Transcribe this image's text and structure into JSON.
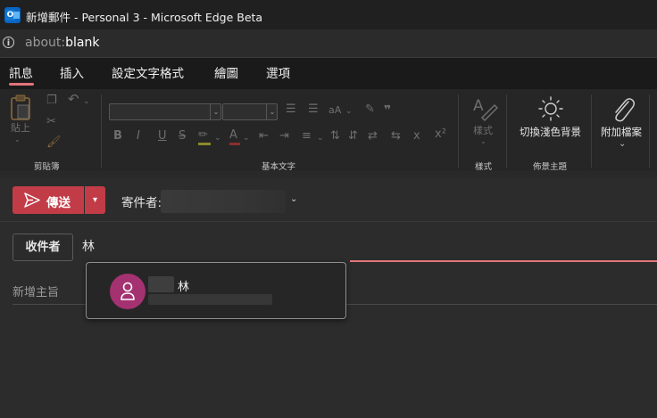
{
  "window": {
    "title": "新增郵件 - Personal 3 - Microsoft Edge Beta"
  },
  "address": {
    "url_prefix": "about:",
    "url_host": "blank"
  },
  "tabs": [
    {
      "label": "訊息",
      "active": true
    },
    {
      "label": "插入"
    },
    {
      "label": "設定文字格式"
    },
    {
      "label": "繪圖"
    },
    {
      "label": "選項"
    }
  ],
  "ribbon": {
    "clipboard": {
      "paste_label": "貼上",
      "group_label": "剪貼簿"
    },
    "basic_text": {
      "group_label": "基本文字",
      "bold": "B",
      "italic": "I",
      "underline": "U",
      "strike": "S",
      "font_size_up": "aA",
      "subscript": "x",
      "superscript": "x²"
    },
    "styles": {
      "button_label": "樣式",
      "group_label": "樣式"
    },
    "theme": {
      "button_label": "切換淺色背景",
      "group_label": "佈景主題"
    },
    "attach": {
      "button_label": "附加檔案"
    }
  },
  "compose": {
    "send_label": "傳送",
    "from_label": "寄件者:",
    "to_label": "收件者",
    "to_value": "林",
    "subject_placeholder": "新增主旨"
  },
  "suggestion": {
    "name_visible": "林"
  },
  "colors": {
    "accent": "#c23c48",
    "avatar": "#a43271",
    "underline": "#e2747b"
  }
}
